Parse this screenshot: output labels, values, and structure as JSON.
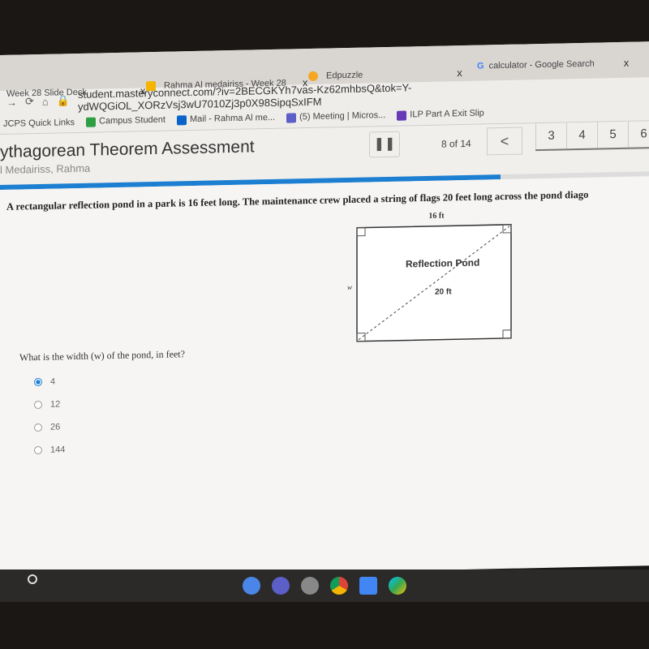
{
  "browser": {
    "tabs": [
      {
        "label": "Week 28 Slide Deck",
        "close": "x"
      },
      {
        "label": "Rahma Al medairiss - Week 28",
        "close": "x"
      },
      {
        "label": "Edpuzzle",
        "close": "x"
      },
      {
        "label": "calculator - Google Search",
        "close": "x"
      }
    ],
    "url": "student.masteryconnect.com/?iv=2BECGKYh7vas-Kz62mhbsQ&tok=Y-ydWQGiOL_XORzVsj3wU7010Zj3p0X98SipqSxIFM",
    "bookmarks": [
      "JCPS Quick Links",
      "Campus Student",
      "Mail - Rahma Al me...",
      "(5) Meeting | Micros...",
      "ILP Part A Exit Slip"
    ]
  },
  "header": {
    "title": "ythagorean Theorem Assessment",
    "student": "l Medairiss, Rahma",
    "count": "8 of 14",
    "prev": "<",
    "pages": [
      "3",
      "4",
      "5",
      "6"
    ]
  },
  "progress": {
    "current": 8,
    "total": 14,
    "accent": "#1d7fd1"
  },
  "question": {
    "text": "A rectangular reflection pond in a park is 16 feet long. The maintenance crew placed a string of flags 20 feet long across the pond diago",
    "figure": {
      "top_label": "16 ft",
      "center_label": "Reflection Pond",
      "side_label": "w",
      "diagonal_label": "20 ft"
    },
    "prompt": "What is the width (w) of the pond, in feet?",
    "options": [
      {
        "label": "4",
        "selected": true
      },
      {
        "label": "12",
        "selected": false
      },
      {
        "label": "26",
        "selected": false
      },
      {
        "label": "144",
        "selected": false
      }
    ]
  }
}
